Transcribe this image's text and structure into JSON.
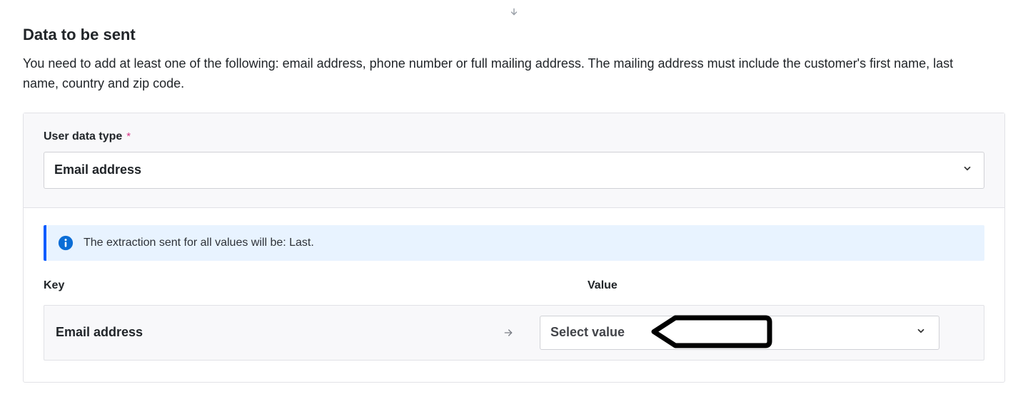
{
  "title": "Data to be sent",
  "description": "You need to add at least one of the following: email address, phone number or full mailing address. The mailing address must include the customer's first name, last name, country and zip code.",
  "userDataType": {
    "label": "User data type",
    "required_marker": "*",
    "selected": "Email address"
  },
  "infoBanner": {
    "text": "The extraction sent for all values will be: Last."
  },
  "headers": {
    "key": "Key",
    "value": "Value"
  },
  "mappingRow": {
    "key": "Email address",
    "valuePlaceholder": "Select value"
  }
}
